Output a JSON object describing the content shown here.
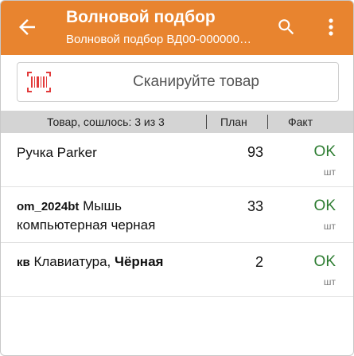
{
  "header": {
    "title": "Волновой подбор",
    "subtitle": "Волновой подбор ВД00-000000…",
    "accent_color": "#e8842f",
    "back_icon": "arrow-left-icon",
    "search_icon": "search-icon",
    "menu_icon": "more-vert-icon"
  },
  "scan": {
    "placeholder": "Сканируйте товар",
    "icon": "barcode-scan-icon"
  },
  "table": {
    "columns": {
      "item": "Товар, сошлось: 3 из 3",
      "plan": "План",
      "fact": "Факт"
    },
    "rows": [
      {
        "code": "",
        "name": "Ручка Parker",
        "variant": "",
        "plan": "93",
        "fact": "OK",
        "unit": "шт"
      },
      {
        "code": "om_2024bt",
        "name": "Мышь компьютерная черная",
        "variant": "",
        "plan": "33",
        "fact": "OK",
        "unit": "шт"
      },
      {
        "code": "кв",
        "name": "Клавиатура,",
        "variant": "Чёрная",
        "plan": "2",
        "fact": "OK",
        "unit": "шт"
      }
    ]
  }
}
